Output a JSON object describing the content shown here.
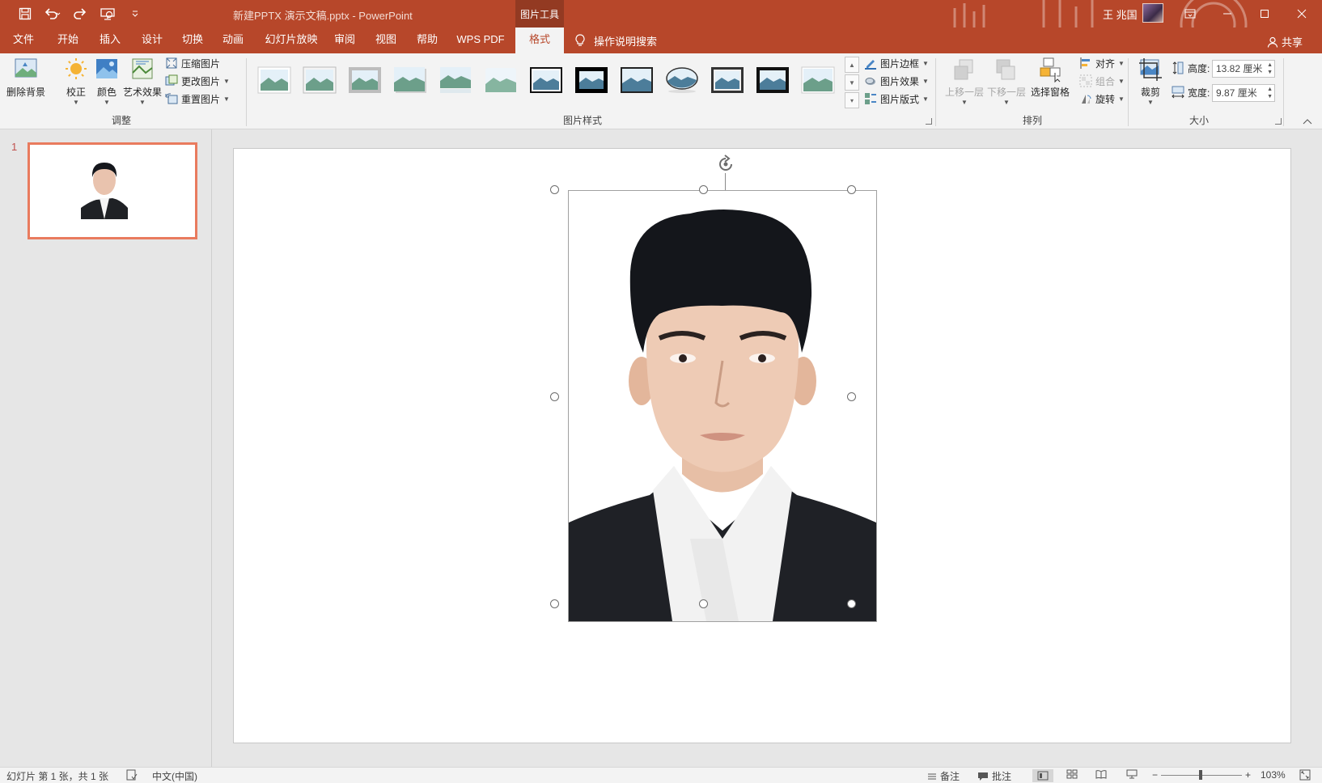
{
  "titlebar": {
    "doc_title": "新建PPTX 演示文稿.pptx  -  PowerPoint",
    "contextual_tab": "图片工具",
    "user_name": "王 兆国",
    "accent_color": "#b7472a"
  },
  "tabs": [
    {
      "label": "文件"
    },
    {
      "label": "开始"
    },
    {
      "label": "插入"
    },
    {
      "label": "设计"
    },
    {
      "label": "切换"
    },
    {
      "label": "动画"
    },
    {
      "label": "幻灯片放映"
    },
    {
      "label": "审阅"
    },
    {
      "label": "视图"
    },
    {
      "label": "帮助"
    },
    {
      "label": "WPS PDF"
    },
    {
      "label": "格式",
      "active": true
    }
  ],
  "search_tab": "操作说明搜索",
  "share": "共享",
  "ribbon": {
    "adjust": {
      "remove_bg": "删除背景",
      "correct": "校正",
      "color": "颜色",
      "artistic": "艺术效果",
      "compress": "压缩图片",
      "change": "更改图片",
      "reset": "重置图片",
      "label": "调整"
    },
    "styles": {
      "label": "图片样式",
      "border": "图片边框",
      "effects": "图片效果",
      "layout": "图片版式"
    },
    "arrange": {
      "label": "排列",
      "bring_forward": "上移一层",
      "send_backward": "下移一层",
      "selection_pane": "选择窗格",
      "align": "对齐",
      "group": "组合",
      "rotate": "旋转"
    },
    "size": {
      "label": "大小",
      "crop": "裁剪",
      "height_label": "高度:",
      "height_value": "13.82 厘米",
      "width_label": "宽度:",
      "width_value": "9.87 厘米"
    }
  },
  "slides": {
    "current_number": "1"
  },
  "status": {
    "slide_info": "幻灯片 第 1 张，共 1 张",
    "language": "中文(中国)",
    "notes": "备注",
    "comments": "批注",
    "zoom": "103%"
  }
}
